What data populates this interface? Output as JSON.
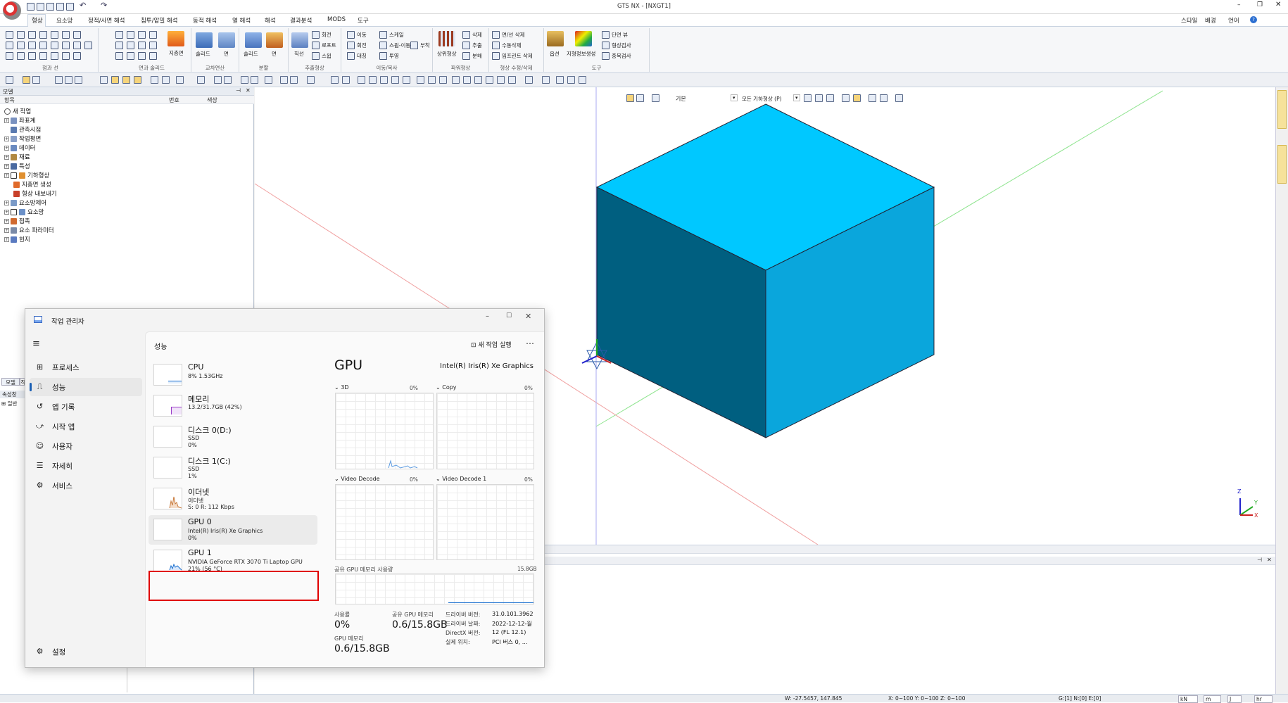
{
  "app": {
    "title": "GTS NX - [NXGT1]",
    "right_menu": [
      "스타일",
      "배경",
      "언어"
    ]
  },
  "ribbon_tabs": [
    "형상",
    "요소망",
    "정적/사면 해석",
    "침투/압밀 해석",
    "동적 해석",
    "열 해석",
    "해석",
    "결과분석",
    "MODS",
    "도구"
  ],
  "ribbon_groups": [
    {
      "label": "점과 선"
    },
    {
      "label": "면과 솔리드",
      "items": [
        "지층면"
      ]
    },
    {
      "label": "교차연산",
      "items": [
        "솔리드",
        "면"
      ]
    },
    {
      "label": "분할",
      "items": [
        "솔리드",
        "면"
      ]
    },
    {
      "label": "추출형상",
      "items": [
        "직선",
        "회전",
        "로프트",
        "스윕"
      ]
    },
    {
      "label": "이동/복사",
      "items": [
        "이동",
        "스케일",
        "회전",
        "스윕-이동",
        "부착",
        "대칭",
        "투영"
      ]
    },
    {
      "label": "파워형상",
      "items": [
        "상위형상",
        "삭제",
        "추출",
        "분해"
      ]
    },
    {
      "label": "형상 수정/삭제",
      "items": [
        "면/선 삭제",
        "수동삭제",
        "임프린트 삭제"
      ]
    },
    {
      "label": "도구",
      "items": [
        "옵션",
        "지형정보생성",
        "단면 뷰",
        "형상검사",
        "중복검사"
      ]
    }
  ],
  "tree": {
    "header": "모델",
    "columns": [
      "항목",
      "번호",
      "색상"
    ],
    "items": [
      "새 작업",
      "좌표계",
      "관측시점",
      "작업평면",
      "데이터",
      "재료",
      "특성",
      "기하형상",
      "지층면 생성",
      "형상 내보내기",
      "요소망제어",
      "요소망",
      "접촉",
      "요소 파라미터",
      "힌지"
    ]
  },
  "side_tabs": {
    "model": "모델",
    "work": "작",
    "properties": "속성창",
    "general": "일반"
  },
  "viewport_toolbar": {
    "style": "기본",
    "filter": "모든 기하형상 (P)"
  },
  "axis_labels": {
    "z": "Z",
    "y": "Y",
    "x": "X"
  },
  "task_manager": {
    "title": "작업 관리자",
    "nav": [
      "프로세스",
      "성능",
      "앱 기록",
      "시작 앱",
      "사용자",
      "자세히",
      "서비스"
    ],
    "settings": "설정",
    "section_title": "성능",
    "run_new_task": "새 작업 실행",
    "devices": [
      {
        "name": "CPU",
        "line1": "8% 1.53GHz",
        "line2": ""
      },
      {
        "name": "메모리",
        "line1": "13.2/31.7GB (42%)",
        "line2": ""
      },
      {
        "name": "디스크 0(D:)",
        "line1": "SSD",
        "line2": "0%"
      },
      {
        "name": "디스크 1(C:)",
        "line1": "SSD",
        "line2": "1%"
      },
      {
        "name": "이더넷",
        "line1": "이더넷",
        "line2": "S: 0 R: 112 Kbps"
      },
      {
        "name": "GPU 0",
        "line1": "Intel(R) Iris(R) Xe Graphics",
        "line2": "0%"
      },
      {
        "name": "GPU 1",
        "line1": "NVIDIA GeForce RTX 3070 Ti Laptop GPU",
        "line2": "21% (56 °C)"
      }
    ],
    "gpu": {
      "heading": "GPU",
      "adapter": "Intel(R) Iris(R) Xe Graphics",
      "engines": [
        {
          "name": "3D",
          "pct": "0%"
        },
        {
          "name": "Copy",
          "pct": "0%"
        },
        {
          "name": "Video Decode",
          "pct": "0%"
        },
        {
          "name": "Video Decode 1",
          "pct": "0%"
        }
      ],
      "shared_memory_label": "공유 GPU 메모리 사용량",
      "shared_memory_max": "15.8GB",
      "utilization_label": "사용률",
      "utilization": "0%",
      "shared_mem_label": "공유 GPU 메모리",
      "shared_mem": "0.6/15.8GB",
      "gpu_mem_label": "GPU 메모리",
      "gpu_mem": "0.6/15.8GB",
      "details": [
        {
          "k": "드라이버 버전:",
          "v": "31.0.101.3962"
        },
        {
          "k": "드라이버 날짜:",
          "v": "2022-12-12-월"
        },
        {
          "k": "DirectX 버전:",
          "v": "12 (FL 12.1)"
        },
        {
          "k": "실제 위치:",
          "v": "PCI 버스 0, ..."
        }
      ]
    }
  },
  "status": {
    "coords": "W: -27.5457, 147.845",
    "ranges": "X: 0~100 Y: 0~100 Z: 0~100",
    "counts": "G:[1] N:[0] E:[0]",
    "units": [
      "kN",
      "m",
      "J",
      "hr"
    ]
  },
  "colors": {
    "cube_top": "#00c8ff",
    "cube_left": "#005f80",
    "cube_right": "#0aa6dc",
    "highlight": "#e00000"
  }
}
